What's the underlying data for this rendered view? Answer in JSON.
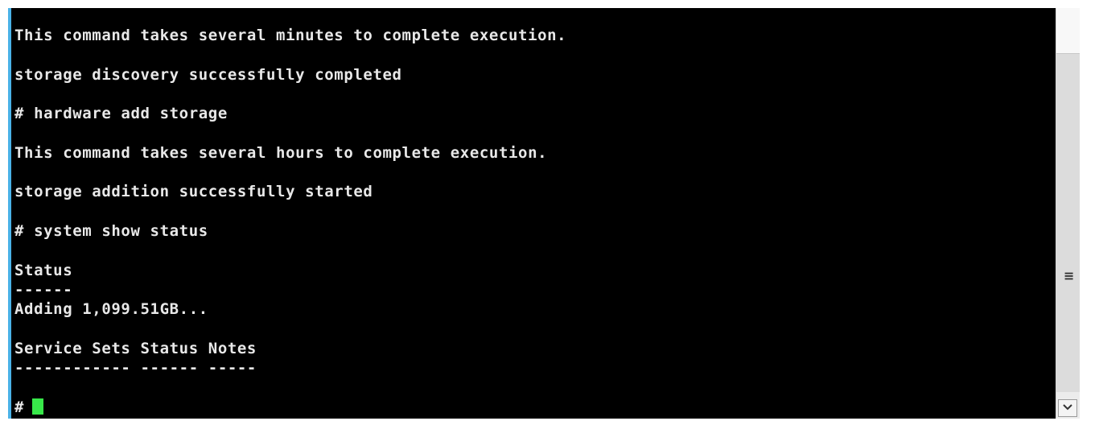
{
  "terminal": {
    "lines": [
      "This command takes several minutes to complete execution.",
      "",
      "storage discovery successfully completed",
      "",
      "# hardware add storage",
      "",
      "This command takes several hours to complete execution.",
      "",
      "storage addition successfully started",
      "",
      "# system show status",
      "",
      "Status",
      "------",
      "Adding 1,099.51GB...",
      "",
      "Service Sets Status Notes",
      "------------ ------ -----",
      "",
      "#"
    ],
    "prompt": "#"
  },
  "colors": {
    "background": "#000000",
    "text": "#e8e8e8",
    "cursor": "#38e84a",
    "accent_border": "#4bb3e8"
  },
  "scrollbar": {
    "grip_icon": "grip-lines-icon",
    "down_icon": "chevron-down-icon"
  }
}
